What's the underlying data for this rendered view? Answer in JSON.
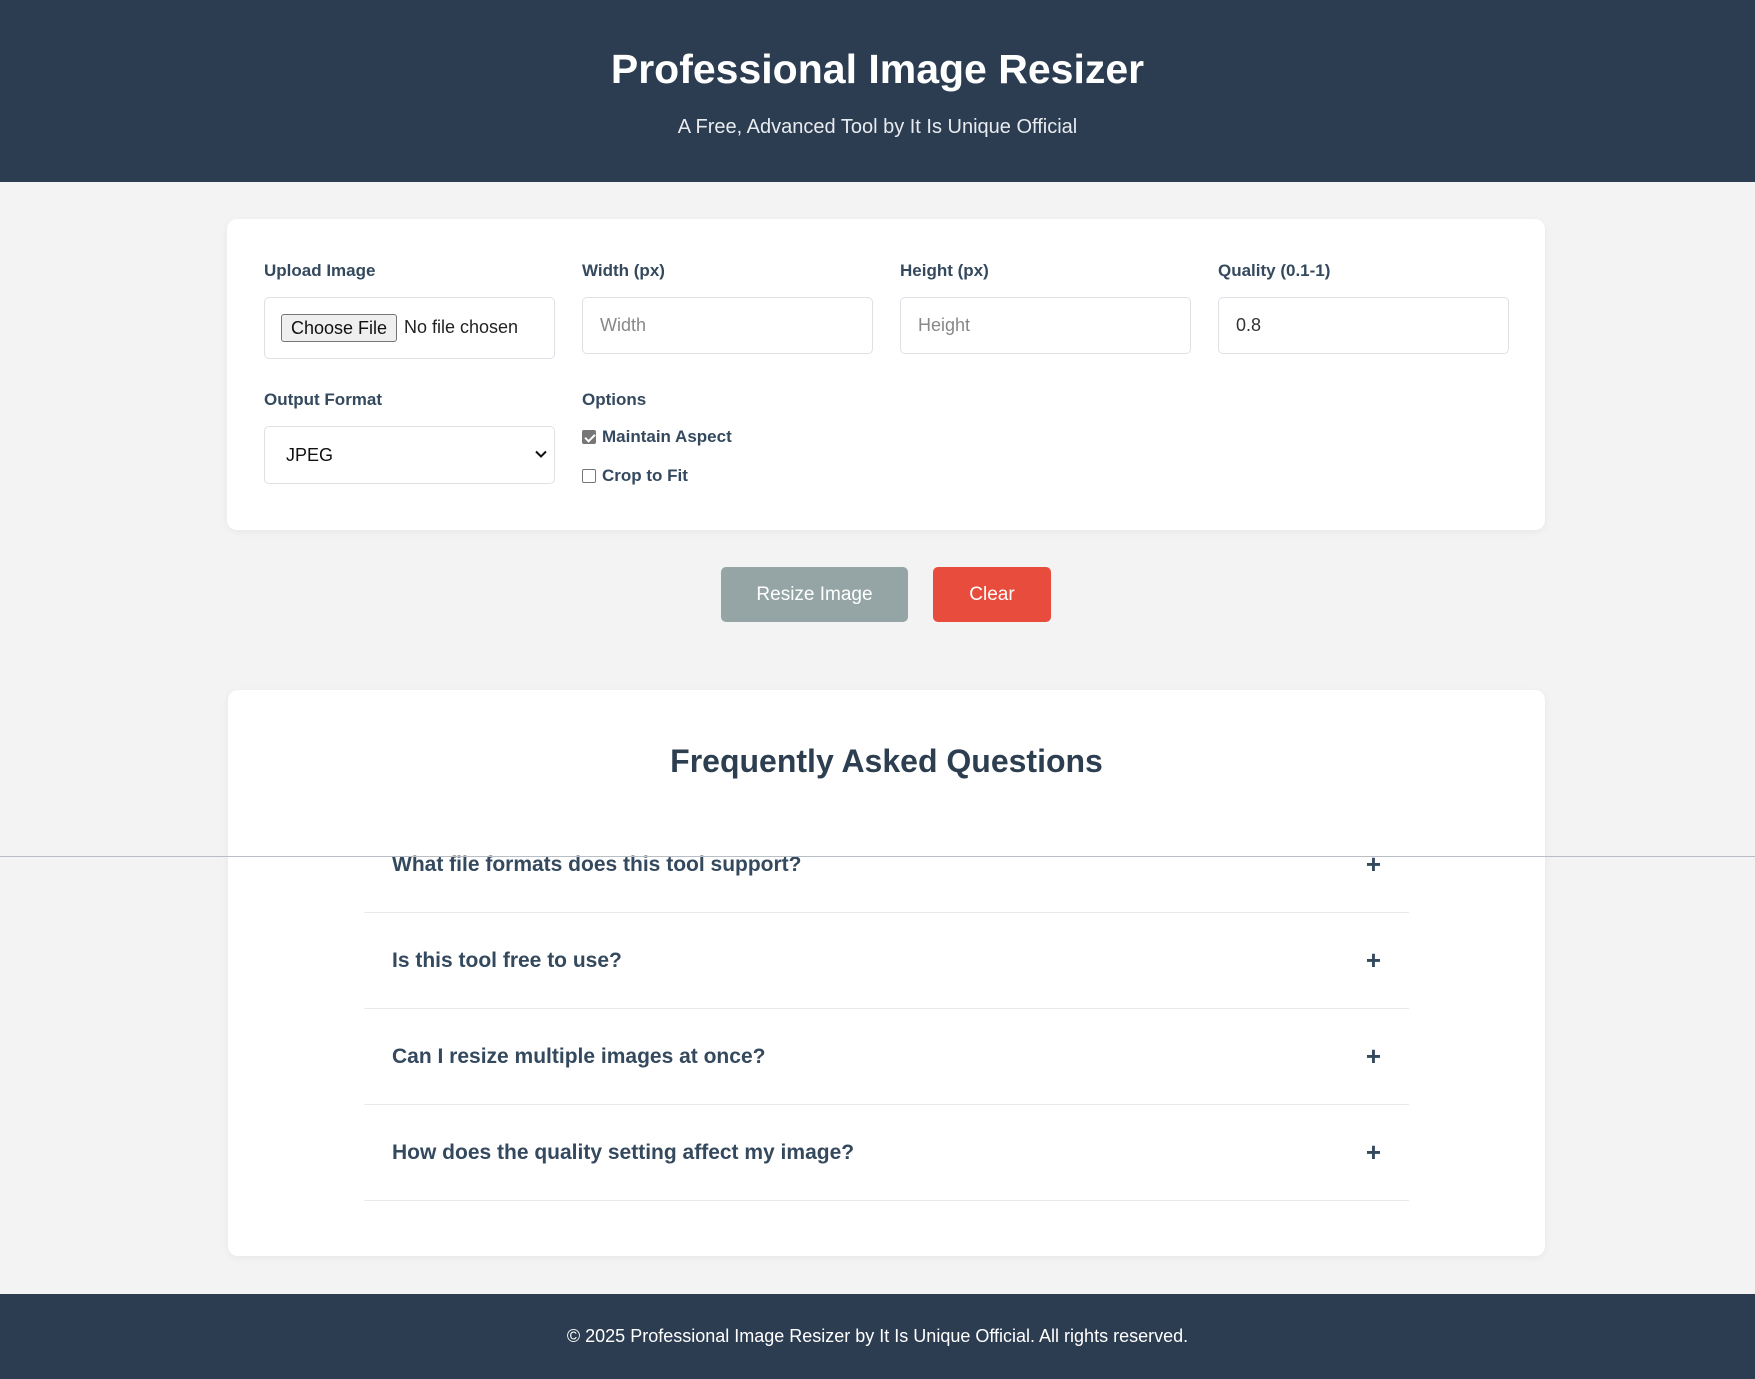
{
  "header": {
    "title": "Professional Image Resizer",
    "subtitle": "A Free, Advanced Tool by It Is Unique Official"
  },
  "form": {
    "upload": {
      "label": "Upload Image",
      "button": "Choose File",
      "status": "No file chosen"
    },
    "width": {
      "label": "Width (px)",
      "placeholder": "Width",
      "value": ""
    },
    "height": {
      "label": "Height (px)",
      "placeholder": "Height",
      "value": ""
    },
    "quality": {
      "label": "Quality (0.1-1)",
      "value": "0.8"
    },
    "format": {
      "label": "Output Format",
      "value": "JPEG"
    },
    "options": {
      "label": "Options",
      "maintain_aspect": {
        "label": "Maintain Aspect",
        "checked": true
      },
      "crop_to_fit": {
        "label": "Crop to Fit",
        "checked": false
      }
    }
  },
  "actions": {
    "resize_label": "Resize Image",
    "clear_label": "Clear"
  },
  "faq": {
    "title": "Frequently Asked Questions",
    "items": [
      {
        "question": "What file formats does this tool support?",
        "icon": "plus-icon",
        "symbol": "+"
      },
      {
        "question": "Is this tool free to use?",
        "icon": "plus-icon",
        "symbol": "+"
      },
      {
        "question": "Can I resize multiple images at once?",
        "icon": "plus-icon",
        "symbol": "+"
      },
      {
        "question": "How does the quality setting affect my image?",
        "icon": "plus-icon",
        "symbol": "+"
      }
    ]
  },
  "footer": {
    "text": "© 2025 Professional Image Resizer by It Is Unique Official. All rights reserved."
  },
  "colors": {
    "header_bg": "#2c3d51",
    "resize_button": "#95a5a6",
    "clear_button": "#e74c3c",
    "page_bg": "#f3f3f4"
  }
}
